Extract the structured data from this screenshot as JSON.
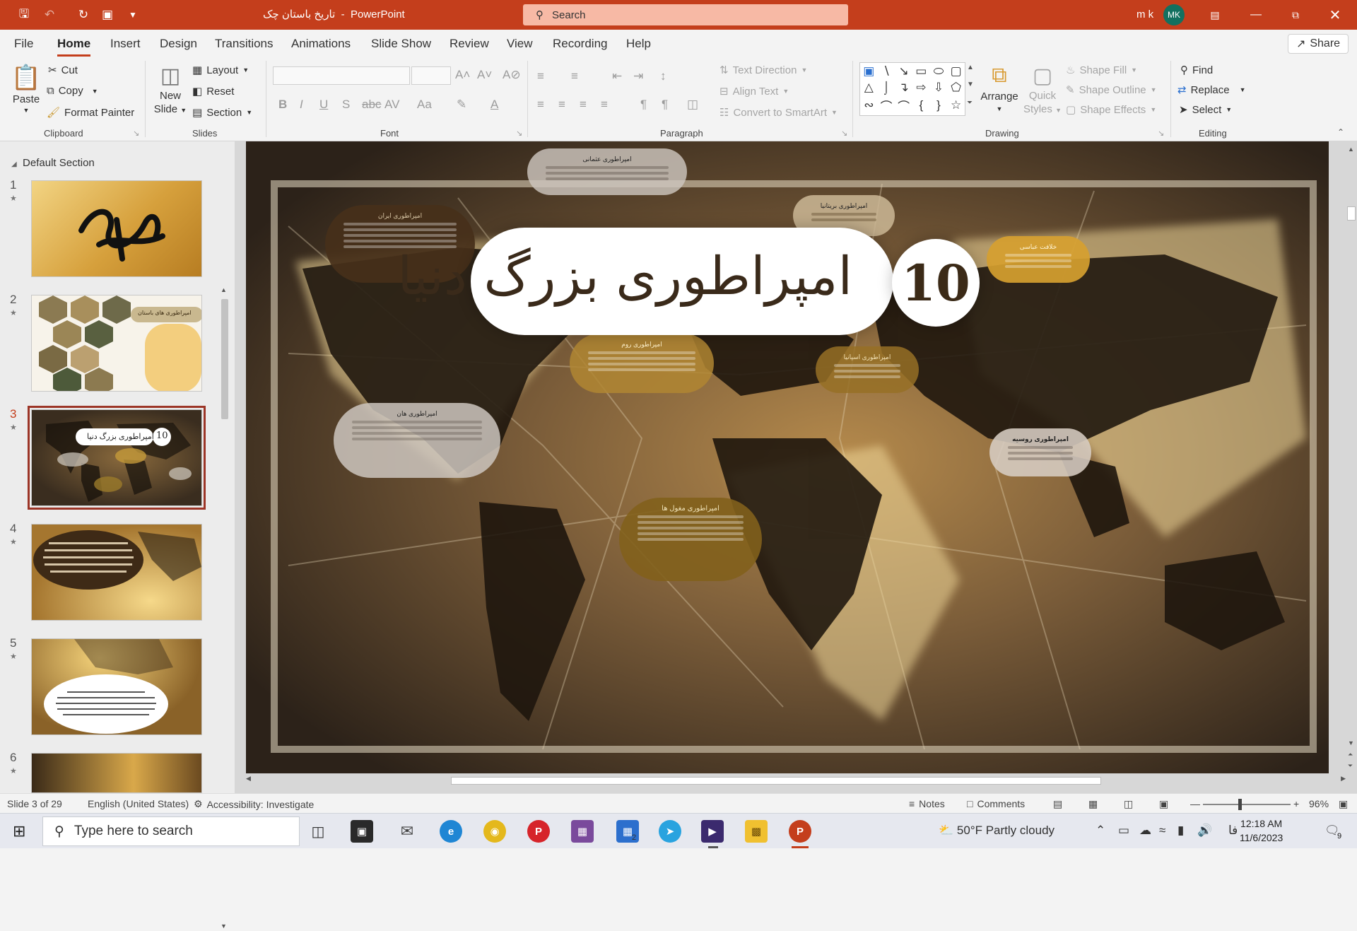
{
  "titlebar": {
    "doc_title": "تاریخ باستان چک",
    "separator": "-",
    "app_name": "PowerPoint",
    "search_placeholder": "Search",
    "user_name": "m k",
    "avatar_initials": "MK"
  },
  "menu": {
    "file": "File",
    "tabs": [
      "Home",
      "Insert",
      "Design",
      "Transitions",
      "Animations",
      "Slide Show",
      "Review",
      "View",
      "Recording",
      "Help"
    ],
    "share": "Share"
  },
  "ribbon": {
    "clipboard": {
      "paste": "Paste",
      "cut": "Cut",
      "copy": "Copy",
      "format_painter": "Format Painter",
      "label": "Clipboard"
    },
    "slides": {
      "new_slide_1": "New",
      "new_slide_2": "Slide",
      "layout": "Layout",
      "reset": "Reset",
      "section": "Section",
      "label": "Slides"
    },
    "font": {
      "label": "Font"
    },
    "paragraph": {
      "text_direction": "Text Direction",
      "align_text": "Align Text",
      "convert_smartart": "Convert to SmartArt",
      "label": "Paragraph"
    },
    "drawing": {
      "arrange": "Arrange",
      "quick_styles_1": "Quick",
      "quick_styles_2": "Styles",
      "shape_fill": "Shape Fill",
      "shape_outline": "Shape Outline",
      "shape_effects": "Shape Effects",
      "label": "Drawing"
    },
    "editing": {
      "find": "Find",
      "replace": "Replace",
      "select": "Select",
      "label": "Editing"
    }
  },
  "thumbnails": {
    "section": "Default Section",
    "slides": [
      {
        "num": "1"
      },
      {
        "num": "2",
        "caption": "امپراطوری های باستان"
      },
      {
        "num": "3",
        "number_badge": "10",
        "title": "امپراطوری بزرگ دنیا"
      },
      {
        "num": "4"
      },
      {
        "num": "5"
      },
      {
        "num": "6"
      }
    ]
  },
  "slide": {
    "number": "10",
    "title": "امپراطوری بزرگ دنیا",
    "bubbles": [
      "امپراطوری عثمانی",
      "امپراطوری ایران",
      "امپراطوری بریتانیا",
      "خلافت عباسی",
      "امپراطوری هان",
      "امپراطوری روسیه",
      "امپراطوری مغول ها",
      "امپراطوری روم",
      "امپراطوری اسپانیا"
    ]
  },
  "status": {
    "slide_info": "Slide 3 of 29",
    "language": "English (United States)",
    "accessibility": "Accessibility: Investigate",
    "notes": "Notes",
    "comments": "Comments",
    "zoom": "96%"
  },
  "taskbar": {
    "search_placeholder": "Type here to search",
    "weather": "50°F Partly cloudy",
    "lang": "فا",
    "time": "12:18 AM",
    "date": "11/6/2023",
    "notifications": "9"
  },
  "colors": {
    "accent": "#c43e1c",
    "slide_bg": "#3d2f22",
    "gold": "#d8a83c"
  }
}
